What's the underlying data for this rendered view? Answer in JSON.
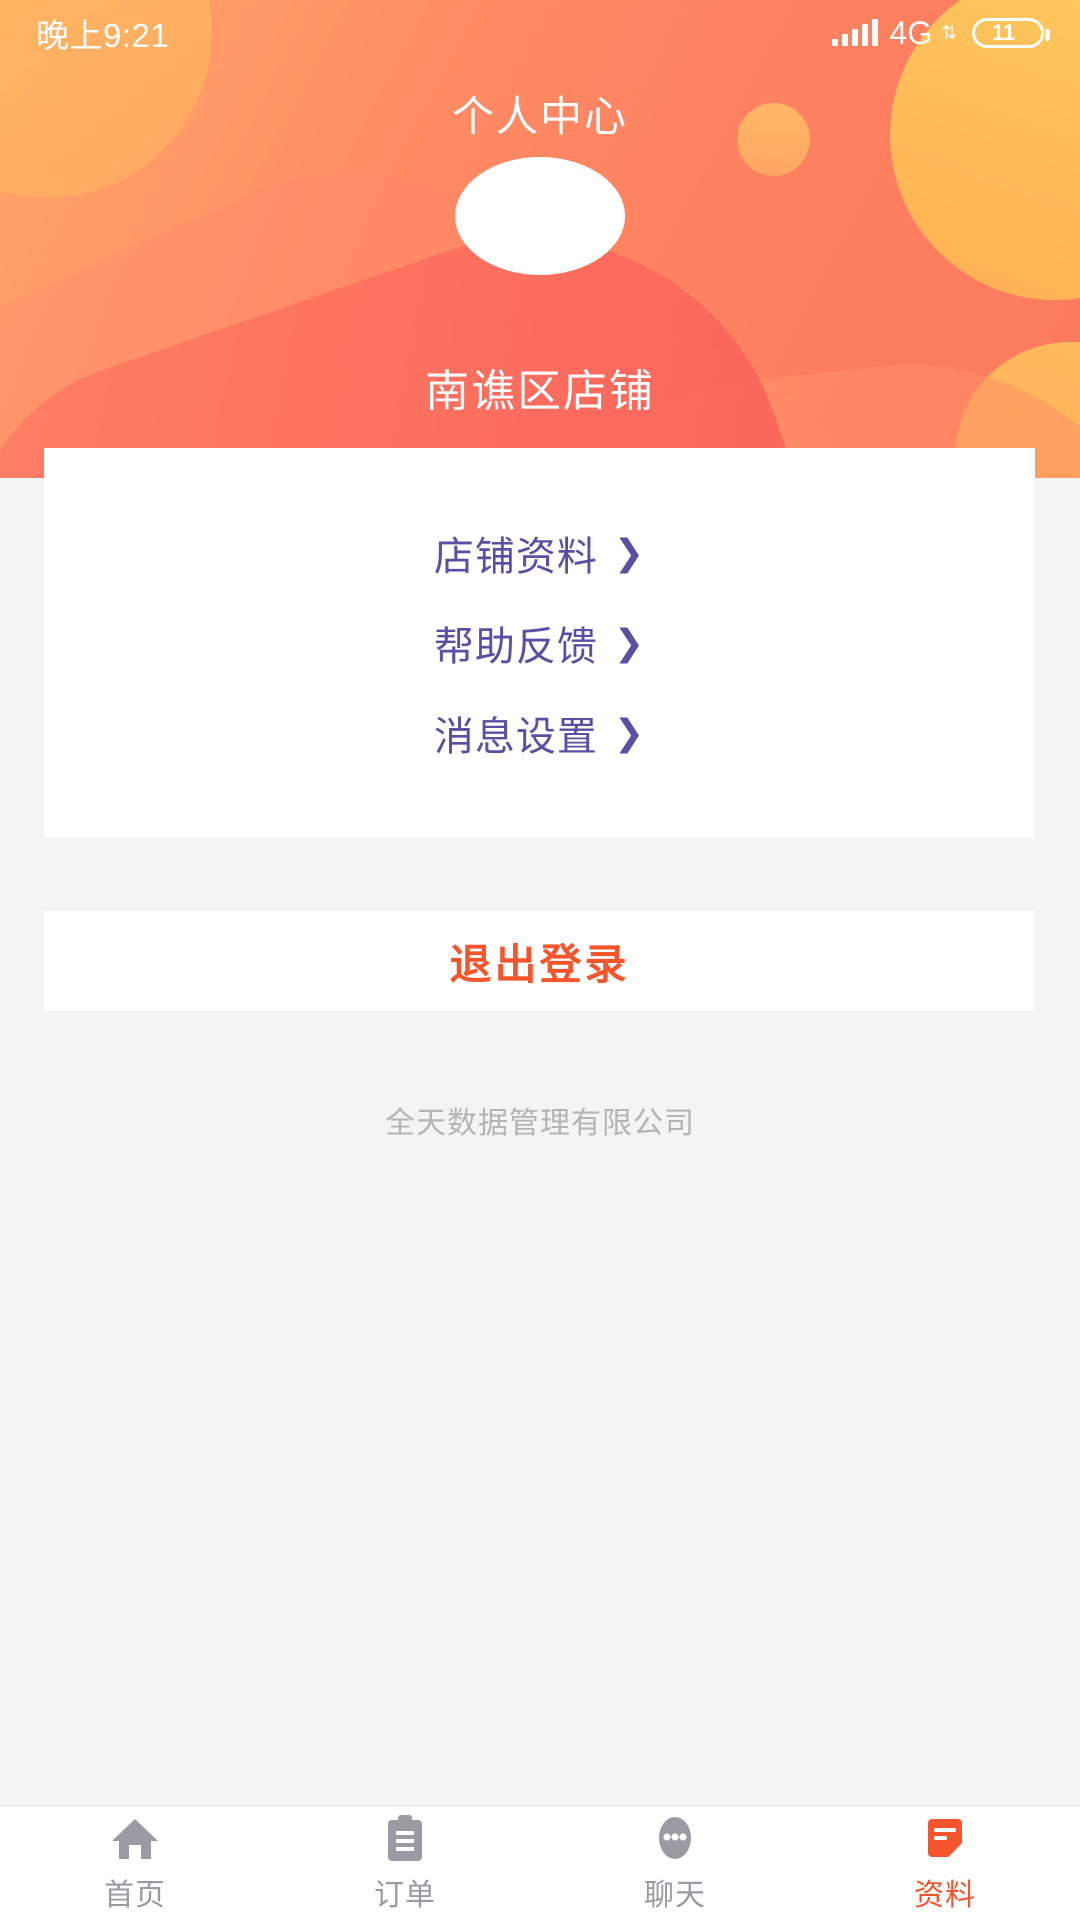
{
  "status_bar": {
    "time": "晚上9:21",
    "network_label": "4G",
    "network_arrows": "⇅",
    "battery_level": "11",
    "signal_icon": "signal-bars-icon"
  },
  "header": {
    "title": "个人中心",
    "shop_name": "南谯区店铺",
    "avatar_placeholder": "",
    "gradient_start": "#ffa86a",
    "gradient_end": "#fb7a5d",
    "accent_yellow": "#ffc25c"
  },
  "menu": {
    "items": [
      {
        "label": "店铺资料",
        "chevron": "❯"
      },
      {
        "label": "帮助反馈",
        "chevron": "❯"
      },
      {
        "label": "消息设置",
        "chevron": "❯"
      }
    ],
    "text_color": "#5a4fa3"
  },
  "logout": {
    "label": "退出登录",
    "color": "#f4552c"
  },
  "footer": {
    "company": "全天数据管理有限公司"
  },
  "tabbar": {
    "items": [
      {
        "label": "首页",
        "icon": "home-icon",
        "active": false
      },
      {
        "label": "订单",
        "icon": "clipboard-icon",
        "active": false
      },
      {
        "label": "聊天",
        "icon": "chat-dots-icon",
        "active": false
      },
      {
        "label": "资料",
        "icon": "document-icon",
        "active": true
      }
    ],
    "active_color": "#f4552c",
    "inactive_color": "#9a9aa3"
  }
}
